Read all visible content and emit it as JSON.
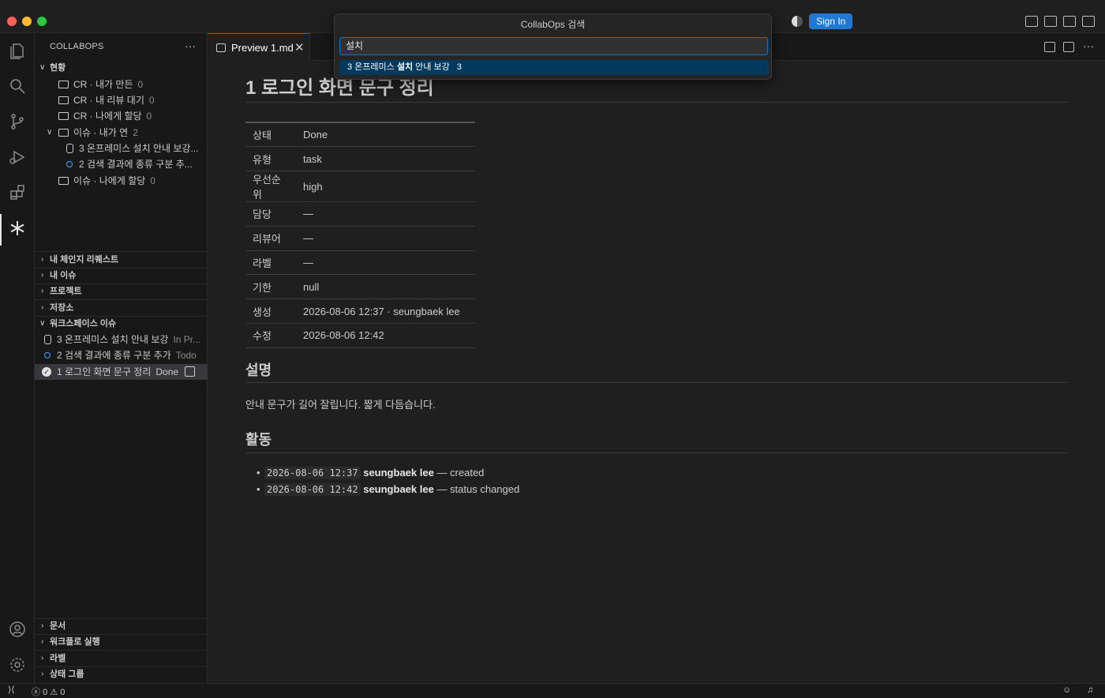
{
  "titlebar": {
    "sign_in": "Sign In"
  },
  "sidebar": {
    "title": "COLLABOPS",
    "status_section": "현황",
    "folders": [
      {
        "label": "CR · 내가 만든",
        "count": "0"
      },
      {
        "label": "CR · 내 리뷰 대기",
        "count": "0"
      },
      {
        "label": "CR · 나에게 할당",
        "count": "0"
      },
      {
        "label": "이슈 · 내가 연",
        "count": "2"
      },
      {
        "label": "이슈 · 나에게 할당",
        "count": "0"
      }
    ],
    "folder_children": [
      {
        "label": "3  온프레미스 설치 안내 보강..."
      },
      {
        "label": "2  검색 결과에 종류 구분 추..."
      }
    ],
    "sections": [
      "내 체인지 리퀘스트",
      "내 이슈",
      "프로젝트",
      "저장소",
      "워크스페이스 이슈"
    ],
    "workspace_issues": [
      {
        "label": "3  온프레미스 설치 안내 보강",
        "status": "In Pr..."
      },
      {
        "label": "2  검색 결과에 종류 구분 추가",
        "status": "Todo"
      },
      {
        "label": "1  로그인 화면 문구 정리",
        "status": "Done"
      }
    ],
    "bottom_sections": [
      "문서",
      "워크플로 실행",
      "라벨",
      "상태 그룹"
    ]
  },
  "tab": {
    "label": "Preview 1.md"
  },
  "doc": {
    "title": "1 로그인 화면 문구 정리",
    "meta": [
      {
        "key": "상태",
        "value": "Done"
      },
      {
        "key": "유형",
        "value": "task"
      },
      {
        "key": "우선순위",
        "value": "high"
      },
      {
        "key": "담당",
        "value": "—"
      },
      {
        "key": "리뷰어",
        "value": "—"
      },
      {
        "key": "라벨",
        "value": "—"
      },
      {
        "key": "기한",
        "value": "null"
      },
      {
        "key": "생성",
        "value": "2026-08-06 12:37 · seungbaek lee"
      },
      {
        "key": "수정",
        "value": "2026-08-06 12:42"
      }
    ],
    "description_heading": "설명",
    "description": "안내 문구가 길어 잘립니다. 짧게 다듬습니다.",
    "activity_heading": "활동",
    "activity": [
      {
        "time": "2026-08-06 12:37",
        "who": "seungbaek lee",
        "what": " — created"
      },
      {
        "time": "2026-08-06 12:42",
        "who": "seungbaek lee",
        "what": " — status changed"
      }
    ]
  },
  "quickpick": {
    "title": "CollabOps 검색",
    "query": "설치",
    "result_prefix": "3  온프레미스 ",
    "result_match": "설치",
    "result_suffix": " 안내 보강",
    "result_count": "3"
  },
  "statusbar": {
    "errors": "0",
    "warnings": "0"
  }
}
